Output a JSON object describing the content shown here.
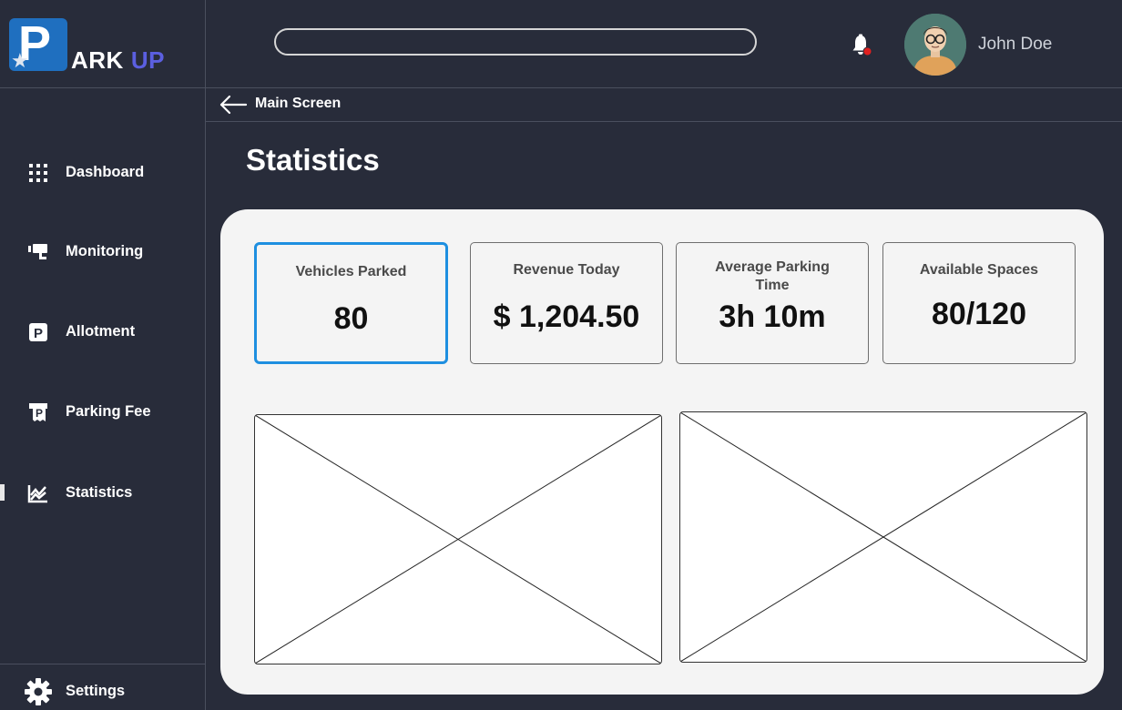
{
  "brand": {
    "logo_letter": "P",
    "name_part1": "ARK",
    "name_part2": "UP"
  },
  "header": {
    "search_placeholder": "",
    "user_name": "John Doe"
  },
  "breadcrumb": {
    "label": "Main Screen"
  },
  "page": {
    "title": "Statistics"
  },
  "sidebar": {
    "items": [
      {
        "label": "Dashboard",
        "icon": "grid-icon"
      },
      {
        "label": "Monitoring",
        "icon": "cctv-camera-icon"
      },
      {
        "label": "Allotment",
        "icon": "parking-sign-icon"
      },
      {
        "label": "Parking Fee",
        "icon": "parking-ticket-icon"
      },
      {
        "label": "Statistics",
        "icon": "chart-icon",
        "active": true
      }
    ],
    "settings": {
      "label": "Settings",
      "icon": "gear-icon"
    }
  },
  "stats": {
    "cards": [
      {
        "title": "Vehicles Parked",
        "value": "80"
      },
      {
        "title": "Revenue Today",
        "value": "$ 1,204.50"
      },
      {
        "title": "Average Parking Time",
        "value": "3h 10m"
      },
      {
        "title": "Available Spaces",
        "value": "80/120"
      }
    ]
  },
  "colors": {
    "background": "#282c3a",
    "panel": "#f4f4f4",
    "accent_blue": "#1e8fe0",
    "brand_blue": "#1f6fbf",
    "brand_purple": "#5b5fe0",
    "notification_red": "#e02020"
  }
}
